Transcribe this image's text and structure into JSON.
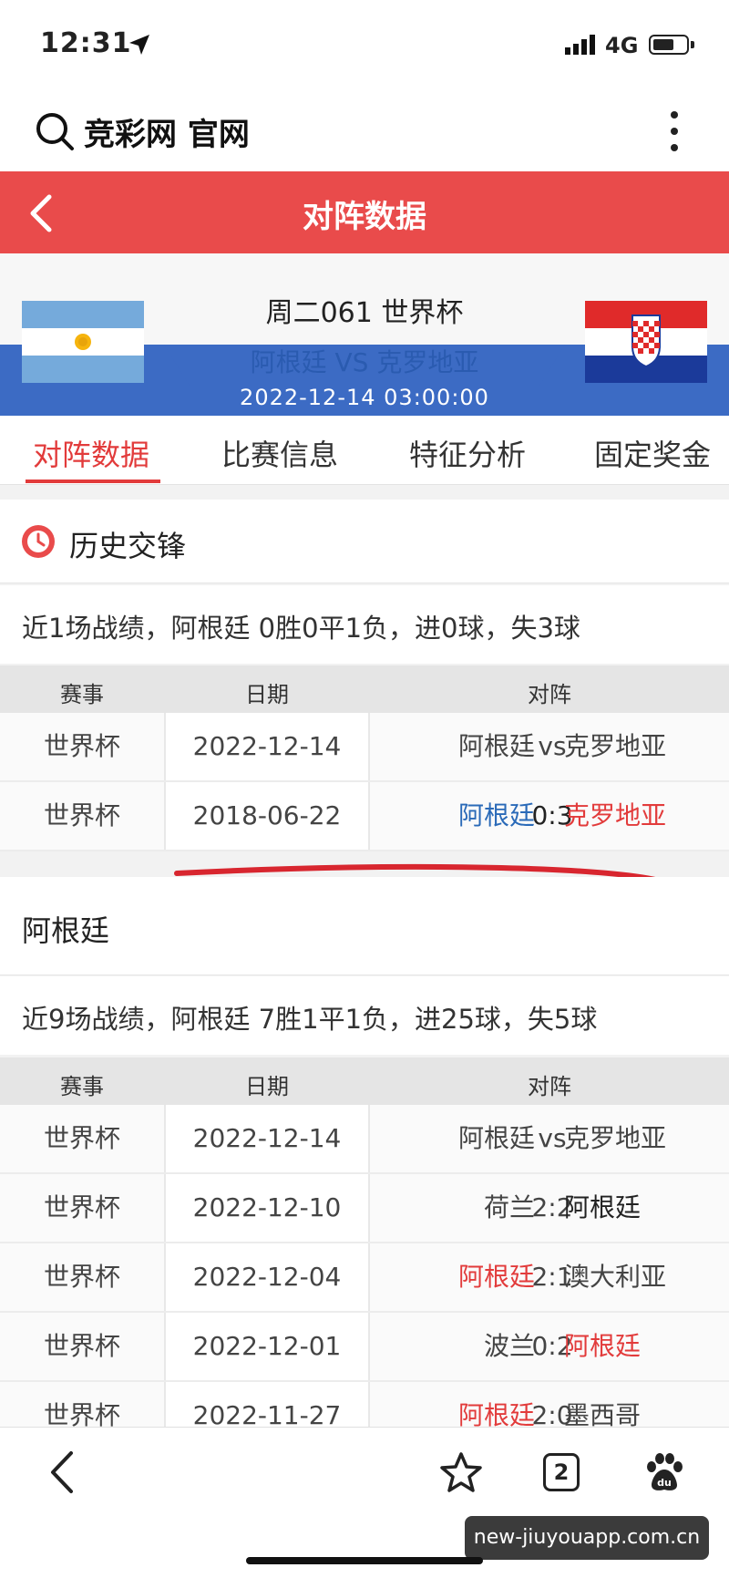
{
  "status_bar": {
    "time": "12:31",
    "network": "4G"
  },
  "address_bar": {
    "site_title": "竞彩网 官网"
  },
  "header": {
    "title": "对阵数据"
  },
  "match": {
    "league": "周二061 世界杯",
    "home": "阿根廷",
    "vs": "VS",
    "away": "克罗地亚",
    "datetime": "2022-12-14 03:00:00"
  },
  "tabs": [
    {
      "label": "对阵数据",
      "active": true
    },
    {
      "label": "比赛信息"
    },
    {
      "label": "特征分析"
    },
    {
      "label": "固定奖金"
    }
  ],
  "history": {
    "section_title": "历史交锋",
    "summary": "近1场战绩，阿根廷 0胜0平1负，进0球，失3球",
    "columns": [
      "赛事",
      "日期",
      "对阵"
    ],
    "rows": [
      {
        "league": "世界杯",
        "date": "2022-12-14",
        "home": "阿根廷",
        "score": "vs",
        "away": "克罗地亚"
      },
      {
        "league": "世界杯",
        "date": "2018-06-22",
        "home": "阿根廷",
        "score": "0:3",
        "away": "克罗地亚"
      }
    ]
  },
  "team": {
    "name": "阿根廷",
    "summary": "近9场战绩，阿根廷 7胜1平1负，进25球，失5球",
    "columns": [
      "赛事",
      "日期",
      "对阵"
    ],
    "rows": [
      {
        "league": "世界杯",
        "date": "2022-12-14",
        "home": "阿根廷",
        "score": "vs",
        "away": "克罗地亚"
      },
      {
        "league": "世界杯",
        "date": "2022-12-10",
        "home": "荷兰",
        "score": "2:2",
        "away": "阿根廷"
      },
      {
        "league": "世界杯",
        "date": "2022-12-04",
        "home": "阿根廷",
        "score": "2:1",
        "away": "澳大利亚"
      },
      {
        "league": "世界杯",
        "date": "2022-12-01",
        "home": "波兰",
        "score": "0:2",
        "away": "阿根廷"
      },
      {
        "league": "世界杯",
        "date": "2022-11-27",
        "home": "阿根廷",
        "score": "2:0",
        "away": "墨西哥"
      }
    ]
  },
  "bottom_bar": {
    "tab_count": "2"
  },
  "watermark": "new-jiuyouapp.com.cn",
  "colors": {
    "accent_red": "#e94b4b",
    "win_red": "#e23b3b",
    "link_blue": "#2a6ab8",
    "banner_blue": "#3c6bc4"
  }
}
